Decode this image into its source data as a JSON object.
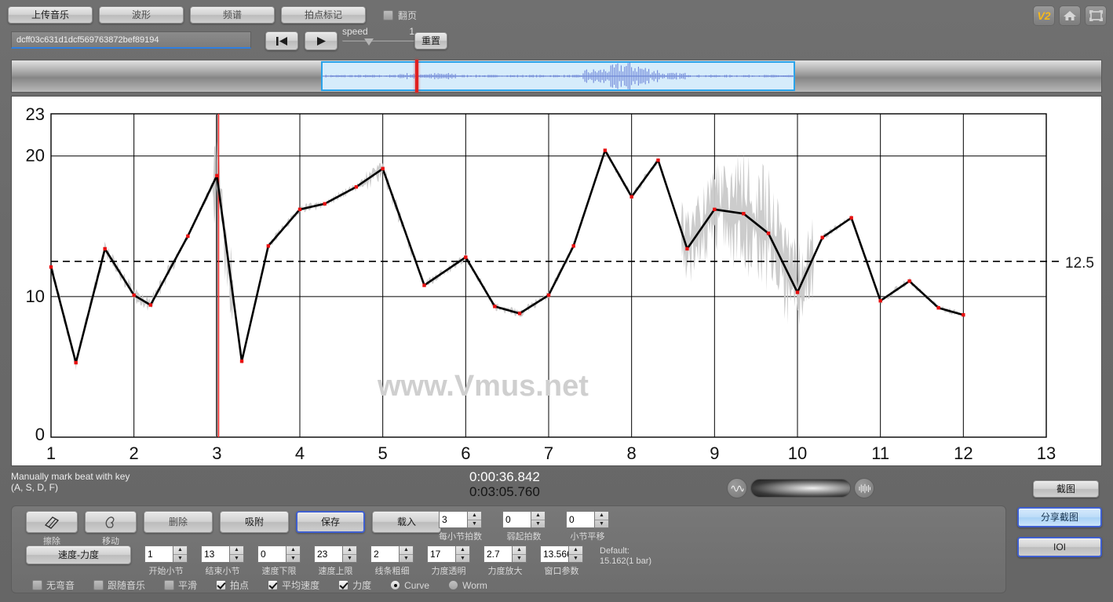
{
  "topbar": {
    "tabs": [
      {
        "label": "上传音乐",
        "name": "upload-music"
      },
      {
        "label": "波形",
        "name": "waveform"
      },
      {
        "label": "频谱",
        "name": "spectrum"
      },
      {
        "label": "拍点标记",
        "name": "beat-marking"
      }
    ],
    "flip_page_label": "翻页",
    "flip_page_checked": false,
    "url_value": "dcff03c631d1dcf569763872bef89194",
    "speed_label": "speed",
    "speed_value": "1",
    "reset_label": "重置",
    "version_badge": "V2"
  },
  "status": {
    "hint_line1": "Manually mark beat with key",
    "hint_line2": "(A, S, D, F)",
    "time_current": "0:00:36.842",
    "time_total": "0:03:05.760",
    "screenshot_label": "截图"
  },
  "toolbar": {
    "erase_label": "擦除",
    "move_label": "移动",
    "delete_label": "删除",
    "snap_label": "吸附",
    "save_label": "保存",
    "load_label": "载入",
    "speed_velocity_label": "速度-力度",
    "fields": [
      {
        "name": "start-bar",
        "value": "1",
        "caption": "开始小节"
      },
      {
        "name": "end-bar",
        "value": "13",
        "caption": "结束小节"
      },
      {
        "name": "speed-lower-limit",
        "value": "0",
        "caption": "速度下限"
      },
      {
        "name": "speed-upper-limit",
        "value": "23",
        "caption": "速度上限"
      },
      {
        "name": "line-width",
        "value": "2",
        "caption": "线条粗细"
      },
      {
        "name": "velocity-transparency",
        "value": "17",
        "caption": "力度透明"
      },
      {
        "name": "velocity-amplify",
        "value": "2.7",
        "caption": "力度放大"
      },
      {
        "name": "window-parameter",
        "value": "13.566",
        "caption": "窗口参数"
      }
    ],
    "counters": [
      {
        "name": "beats-per-bar",
        "value": "3",
        "caption": "每小节拍数"
      },
      {
        "name": "pickup-beats",
        "value": "0",
        "caption": "弱起拍数"
      },
      {
        "name": "bar-shift",
        "value": "0",
        "caption": "小节平移"
      }
    ],
    "default_note_line1": "Default:",
    "default_note_line2": "15.162(1 bar)",
    "checkboxes": [
      {
        "name": "no-bend",
        "label": "无弯音",
        "checked": false
      },
      {
        "name": "follow-music",
        "label": "跟随音乐",
        "checked": false
      },
      {
        "name": "smooth",
        "label": "平滑",
        "checked": false
      },
      {
        "name": "beat",
        "label": "拍点",
        "checked": true
      },
      {
        "name": "average-speed",
        "label": "平均速度",
        "checked": true
      },
      {
        "name": "velocity",
        "label": "力度",
        "checked": true
      }
    ],
    "radios": [
      {
        "name": "curve",
        "label": "Curve",
        "selected": true
      },
      {
        "name": "worm",
        "label": "Worm",
        "selected": false
      }
    ]
  },
  "rightpanel": {
    "share_label": "分享截图",
    "ioi_label": "IOI"
  },
  "chart_data": {
    "type": "line",
    "title": "",
    "watermark": "www.Vmus.net",
    "xlabel": "",
    "ylabel": "",
    "xlim": [
      1,
      13
    ],
    "ylim": [
      0,
      23
    ],
    "xticks": [
      1,
      2,
      3,
      4,
      5,
      6,
      7,
      8,
      9,
      10,
      11,
      12,
      13
    ],
    "yticks": [
      0,
      10,
      20,
      23
    ],
    "grid": true,
    "mean_line": {
      "value": 12.5,
      "label": "12.5",
      "style": "dashed"
    },
    "playhead_x": 3.02,
    "series": [
      {
        "name": "tempo-curve",
        "color": "#000000",
        "marker_color": "#e81010",
        "x": [
          1.0,
          1.3,
          1.65,
          2.0,
          2.2,
          2.65,
          3.0,
          3.3,
          3.62,
          4.0,
          4.3,
          4.68,
          5.0,
          5.5,
          6.0,
          6.35,
          6.65,
          7.0,
          7.3,
          7.68,
          8.0,
          8.32,
          8.67,
          9.0,
          9.35,
          9.65,
          10.0,
          10.3,
          10.65,
          11.0,
          11.35,
          11.7,
          12.0
        ],
        "y": [
          12.1,
          5.3,
          13.4,
          10.1,
          9.4,
          14.3,
          18.6,
          5.4,
          13.6,
          16.2,
          16.6,
          17.8,
          19.1,
          10.8,
          12.8,
          9.3,
          8.8,
          10.1,
          13.6,
          20.4,
          17.1,
          19.7,
          13.4,
          16.2,
          15.9,
          14.5,
          10.3,
          14.2,
          15.6,
          9.7,
          11.1,
          9.2,
          8.7
        ]
      }
    ],
    "variance_band": {
      "name": "raw-variance",
      "color": "#c8c8c8",
      "description": "gray raw tempo envelope around smoothed curve"
    }
  }
}
